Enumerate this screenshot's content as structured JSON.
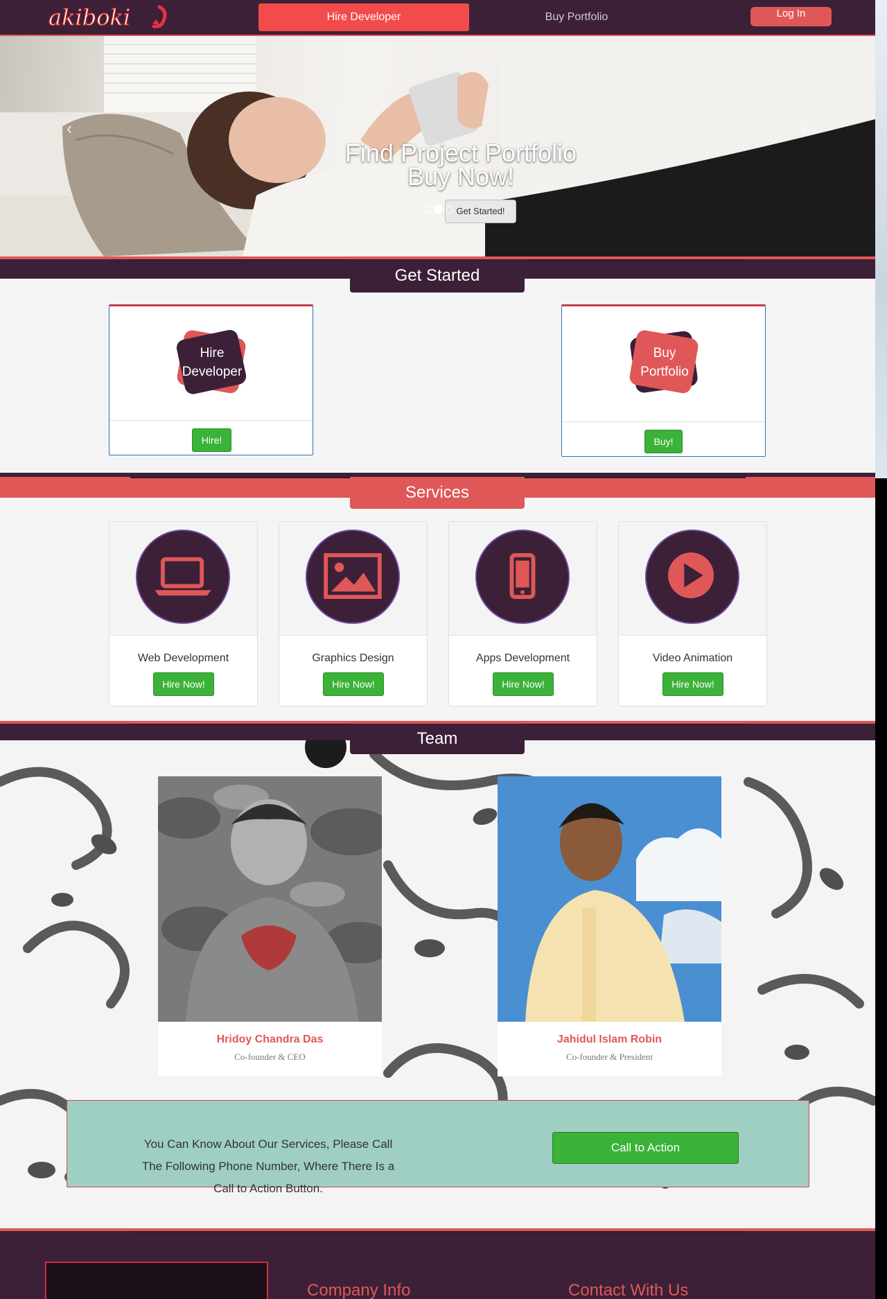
{
  "nav": {
    "logo_text": "akiboki",
    "hire_label": "Hire Developer",
    "buy_label": "Buy Portfolio",
    "login_label": "Log In"
  },
  "hero": {
    "line1": "Find Project Portfolio",
    "line2": "Buy Now!",
    "button": "Get Started!",
    "slides": 3,
    "active_slide": 2,
    "prev_arrow": "‹",
    "next_arrow": "›"
  },
  "get_started": {
    "title": "Get Started",
    "cards": [
      {
        "line1": "Hire",
        "line2": "Developer",
        "button": "Hire!"
      },
      {
        "line1": "Buy",
        "line2": "Portfolio",
        "button": "Buy!"
      }
    ]
  },
  "services": {
    "title": "Services",
    "items": [
      {
        "title": "Web Development",
        "icon": "laptop-icon",
        "button": "Hire Now!"
      },
      {
        "title": "Graphics Design",
        "icon": "image-icon",
        "button": "Hire Now!"
      },
      {
        "title": "Apps Development",
        "icon": "mobile-icon",
        "button": "Hire Now!"
      },
      {
        "title": "Video Animation",
        "icon": "play-icon",
        "button": "Hire Now!"
      }
    ]
  },
  "team": {
    "title": "Team",
    "members": [
      {
        "name": "Hridoy Chandra Das",
        "role": "Co-founder & CEO"
      },
      {
        "name": "Jahidul Islam Robin",
        "role": "Co-founder & President"
      }
    ]
  },
  "cta": {
    "text": "You Can Know About Our Services, Please Call The Following Phone Number, Where There Is a Call to Action Button.",
    "button": "Call to Action"
  },
  "footer": {
    "company_info": "Company Info",
    "contact": "Contact With Us"
  },
  "colors": {
    "primary_dark": "#3b2038",
    "accent_red": "#e05757",
    "success_green": "#3bb238",
    "cta_teal": "#9ecfc2"
  }
}
